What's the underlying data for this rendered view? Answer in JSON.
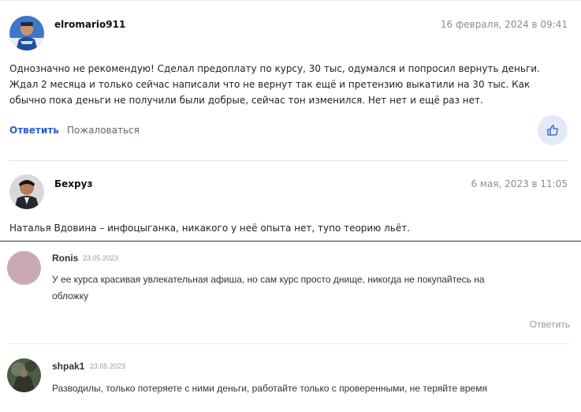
{
  "comments_top": [
    {
      "author": "elromario911",
      "date": "16 февраля, 2024 в 09:41",
      "text": "Однозначно не рекомендую! Сделал предоплату по курсу, 30 тыс, одумался и попросил вернуть деньги. Ждал 2 месяца и только сейчас написали что не вернут так ещё и претензию выкатили на 30 тыс. Как обычно пока деньги не получили были добрые, сейчас тон изменился. Нет нет и ещё раз нет.",
      "reply_label": "Ответить",
      "report_label": "Пожаловаться",
      "like_icon": "thumbs-up-icon"
    },
    {
      "author": "Бехруз",
      "date": "6 мая, 2023 в 11:05",
      "text": "Наталья Вдовина – инфоцыганка, никакого у неё опыта нет, тупо теорию льёт."
    }
  ],
  "comments_bottom": [
    {
      "author": "Ronis",
      "date": "23.05.2023",
      "text": "У ее курса красивая увлекательная афиша, но сам курс просто днище, никогда не покупайтесь на обложку",
      "reply_label": "Ответить",
      "avatar_color": "#c9a9b5"
    },
    {
      "author": "shpak1",
      "date": "23.05.2023",
      "text": "Разводилы, только потеряете с ними деньги, работайте только с проверенными, не теряйте время"
    }
  ],
  "colors": {
    "accent": "#2d5bd0",
    "like_bg": "#e4e9f7"
  }
}
